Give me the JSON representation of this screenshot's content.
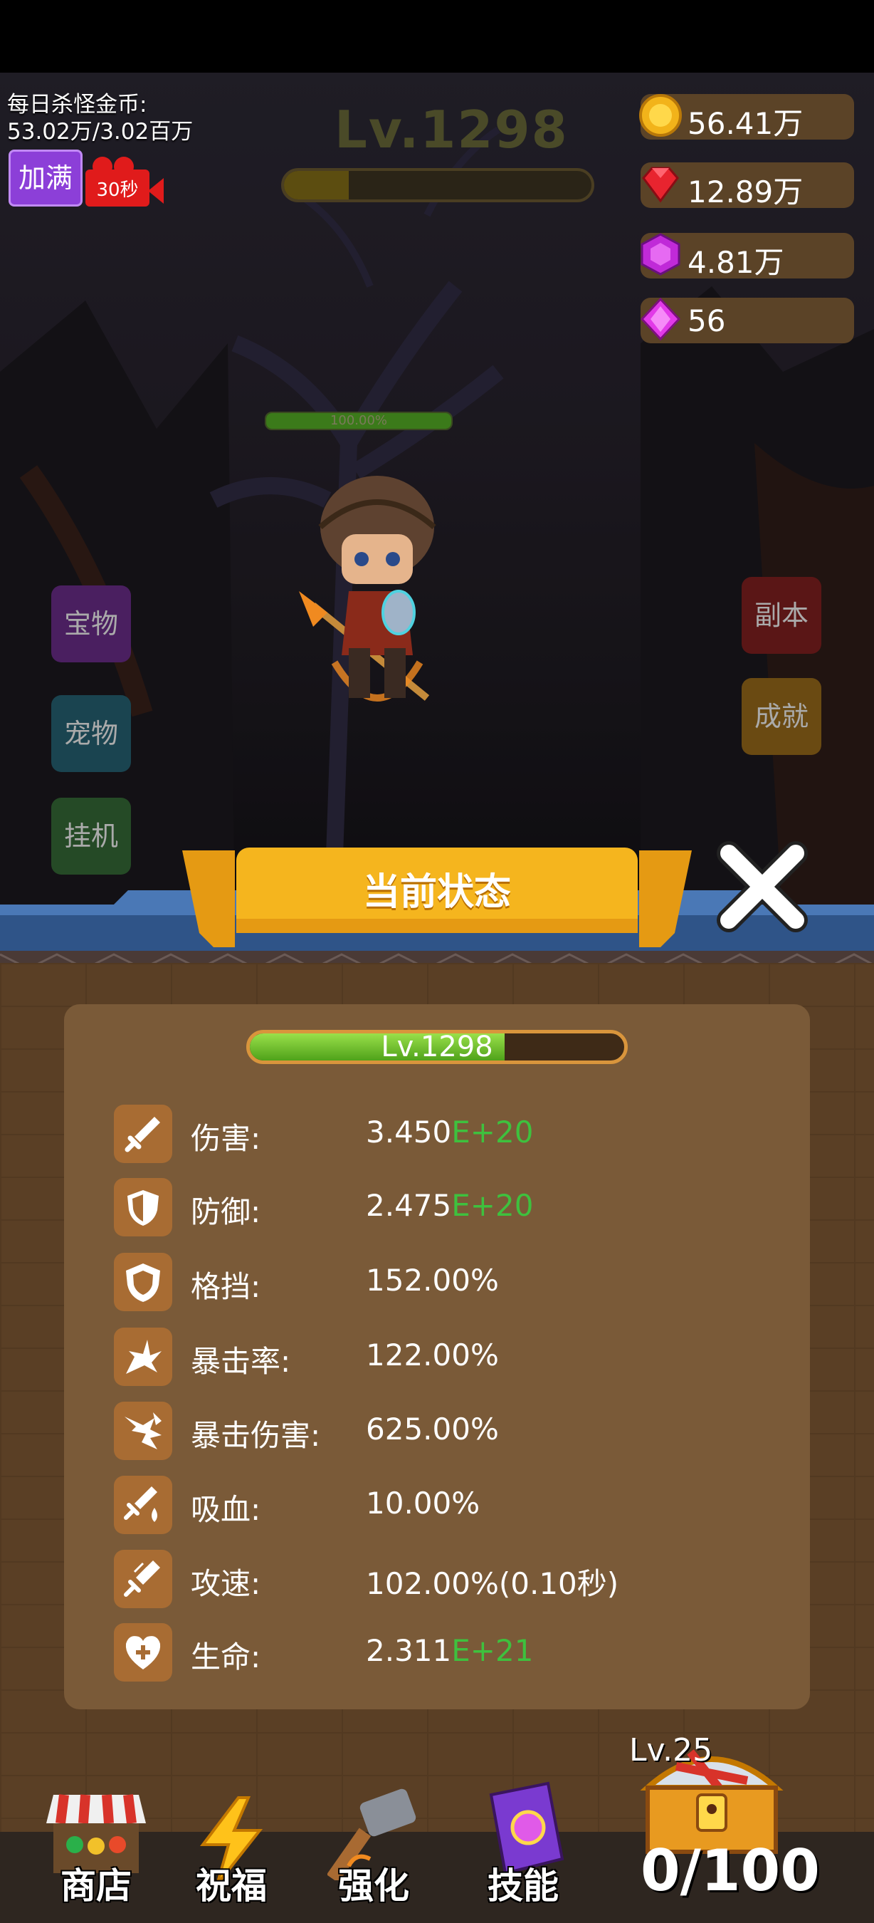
{
  "hud": {
    "daily_label": "每日杀怪金币:",
    "daily_value": "53.02万/3.02百万",
    "add_full_label": "加满",
    "ad_timer": "30秒",
    "level": "Lv.1298",
    "xp_progress": 0.21
  },
  "resources": [
    {
      "name": "gold",
      "value": "56.41万",
      "icon": "gold-coin-icon"
    },
    {
      "name": "red-gem",
      "value": "12.89万",
      "icon": "red-gem-icon"
    },
    {
      "name": "purple-gem",
      "value": "4.81万",
      "icon": "purple-gem-icon"
    },
    {
      "name": "diamond",
      "value": "56",
      "icon": "diamond-icon"
    }
  ],
  "enemy_hp": {
    "text": "100.00%",
    "progress": 1.0
  },
  "side_buttons": {
    "treasure": "宝物",
    "pet": "宠物",
    "idle": "挂机",
    "dungeon": "副本",
    "achievement": "成就"
  },
  "panel": {
    "title": "当前状态",
    "level": "Lv.1298",
    "level_progress": 0.68,
    "stats": [
      {
        "icon": "sword-icon",
        "label": "伤害:",
        "value": "3.450",
        "exp": "E+20"
      },
      {
        "icon": "shield-icon",
        "label": "防御:",
        "value": "2.475",
        "exp": "E+20"
      },
      {
        "icon": "block-shield-icon",
        "label": "格挡:",
        "value": "152.00%",
        "exp": ""
      },
      {
        "icon": "crit-burst-icon",
        "label": "暴击率:",
        "value": "122.00%",
        "exp": ""
      },
      {
        "icon": "crit-damage-icon",
        "label": "暴击伤害:",
        "value": "625.00%",
        "exp": ""
      },
      {
        "icon": "lifesteal-icon",
        "label": "吸血:",
        "value": "10.00%",
        "exp": ""
      },
      {
        "icon": "attack-speed-icon",
        "label": "攻速:",
        "value": "102.00%(0.10秒)",
        "exp": ""
      },
      {
        "icon": "heart-plus-icon",
        "label": "生命:",
        "value": "2.311",
        "exp": "E+21"
      }
    ]
  },
  "nav": {
    "shop": "商店",
    "blessing": "祝福",
    "enhance": "强化",
    "skill": "技能"
  },
  "chest": {
    "level": "Lv.25",
    "count": "0/100"
  },
  "colors": {
    "accent_green": "#3ec13e",
    "panel_brown": "#7a5a38",
    "title_yellow": "#f5b51e"
  }
}
